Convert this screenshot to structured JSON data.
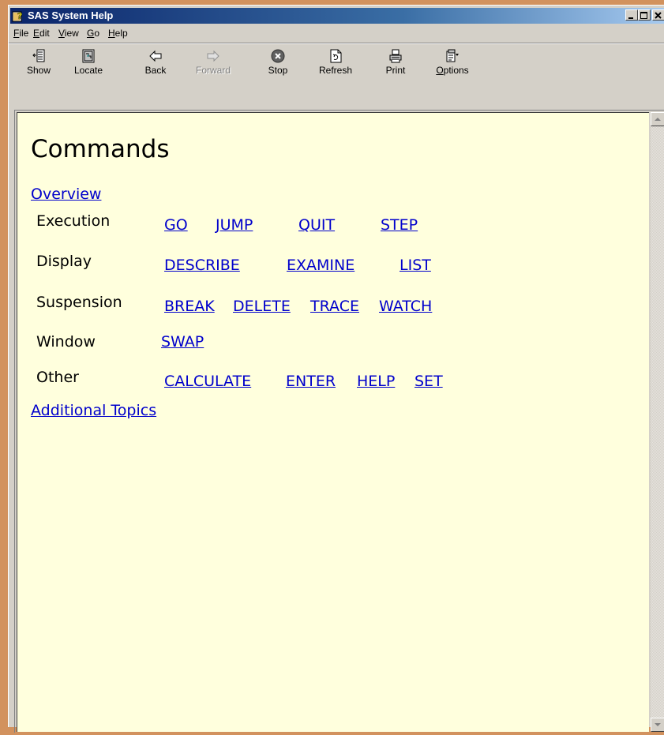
{
  "window": {
    "title": "SAS System Help"
  },
  "menubar": {
    "items": [
      "File",
      "Edit",
      "View",
      "Go",
      "Help"
    ]
  },
  "toolbar": {
    "buttons": [
      {
        "label": "Show",
        "icon": "show-icon"
      },
      {
        "label": "Locate",
        "icon": "locate-icon"
      },
      {
        "label": "Back",
        "icon": "back-arrow-icon"
      },
      {
        "label": "Forward",
        "icon": "forward-arrow-icon",
        "disabled": true
      },
      {
        "label": "Stop",
        "icon": "stop-icon"
      },
      {
        "label": "Refresh",
        "icon": "refresh-icon"
      },
      {
        "label": "Print",
        "icon": "print-icon"
      },
      {
        "label": "Options",
        "icon": "options-icon"
      }
    ]
  },
  "content": {
    "title": "Commands",
    "overview_link": "Overview",
    "rows": [
      {
        "label": "Execution",
        "links": [
          "GO",
          "JUMP",
          "QUIT",
          "STEP"
        ]
      },
      {
        "label": "Display",
        "links": [
          "DESCRIBE",
          "EXAMINE",
          "LIST"
        ]
      },
      {
        "label": "Suspension",
        "links": [
          "BREAK",
          "DELETE",
          "TRACE",
          "WATCH"
        ]
      },
      {
        "label": "Window",
        "links": [
          "SWAP"
        ]
      },
      {
        "label": "Other",
        "links": [
          "CALCULATE",
          "ENTER",
          "HELP",
          "SET"
        ]
      }
    ],
    "additional_link": "Additional Topics"
  },
  "colors": {
    "desktop": "#d2925e",
    "page_background": "#ffffdd",
    "link": "#0000cc"
  }
}
